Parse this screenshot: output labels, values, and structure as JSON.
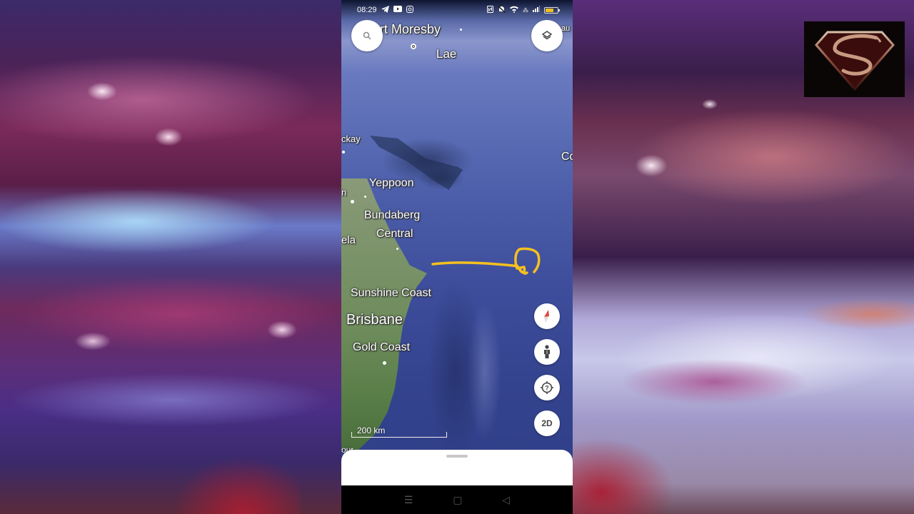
{
  "status_bar": {
    "time": "08:29",
    "left_icons": [
      "telegram-icon",
      "youtube-icon",
      "instagram-icon"
    ],
    "right_icons": [
      "nfc-icon",
      "mute-icon",
      "wifi-icon",
      "signal-icon",
      "battery-icon"
    ],
    "battery_level": 0.7,
    "battery_color": "#f0c020"
  },
  "map": {
    "labels": {
      "port_moresby": "ort Moresby",
      "lae": "Lae",
      "mackay": "ckay",
      "yeppoon": "Yeppoon",
      "bundaberg": "Bundaberg",
      "central": "Central",
      "ela": "ela",
      "n_partial": "n",
      "sunshine_coast": "Sunshine Coast",
      "brisbane": "Brisbane",
      "gold_coast": "Gold Coast",
      "co_partial": "Co",
      "au_partial": "au",
      "our_partial": "our"
    },
    "scale_label": "200 km",
    "annotation_color": "#f5c020"
  },
  "controls": {
    "search_icon": "search-icon",
    "layers_icon": "layers-icon",
    "compass_icon": "compass-icon",
    "street_view_icon": "pegman-icon",
    "location_icon": "locate-icon",
    "view_mode_label": "2D"
  },
  "nav_bar": {
    "menu_icon": "☰",
    "home_icon": "▢",
    "back_icon": "◁"
  },
  "overlay": {
    "logo": "superman-logo"
  }
}
